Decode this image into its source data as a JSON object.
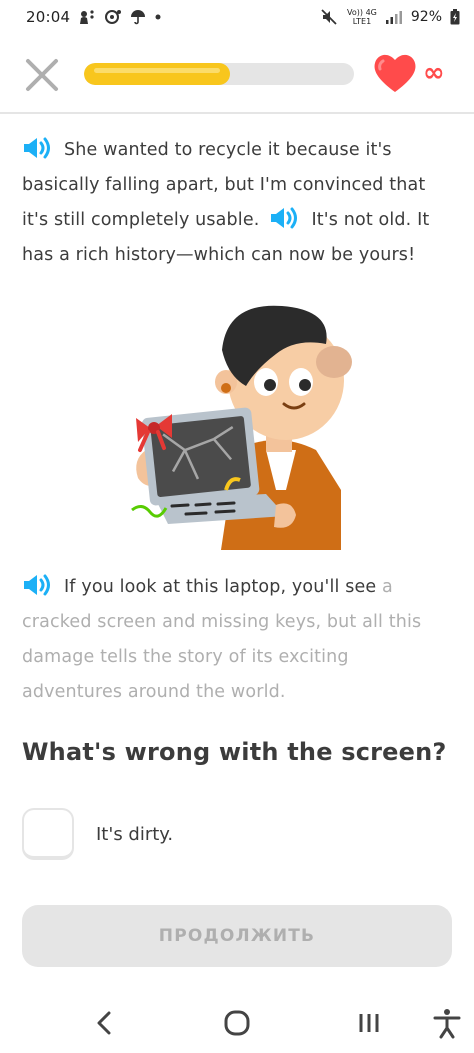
{
  "status_bar": {
    "time": "20:04",
    "battery": "92%",
    "network_top": "Vo)) 4G",
    "network_bottom": "LTE1"
  },
  "header": {
    "progress_fraction": 0.54,
    "hearts_count": "∞",
    "accent_color": "#f8c61d",
    "heart_color": "#ff4b4b"
  },
  "story": {
    "paragraph1_part1": "She wanted to recycle it because it's basically falling apart, but I'm convinced that it's still completely usable.",
    "paragraph1_part2": "It's not old. It has a rich history—which can now be yours!",
    "paragraph2_read": "If you look at this laptop, you'll see",
    "paragraph2_unread": "a cracked screen and missing keys, but all this damage tells the story of its exciting adventures around the world."
  },
  "question": {
    "text": "What's wrong with the screen?",
    "options": [
      {
        "label": "It's dirty."
      }
    ]
  },
  "continue_button": {
    "label": "ПРОДОЛЖИТЬ"
  },
  "icons": {
    "close": "close-icon",
    "heart": "heart-icon",
    "speaker": "speaker-icon",
    "back": "back-icon",
    "home": "home-icon",
    "recents": "recents-icon",
    "accessibility": "accessibility-icon"
  }
}
